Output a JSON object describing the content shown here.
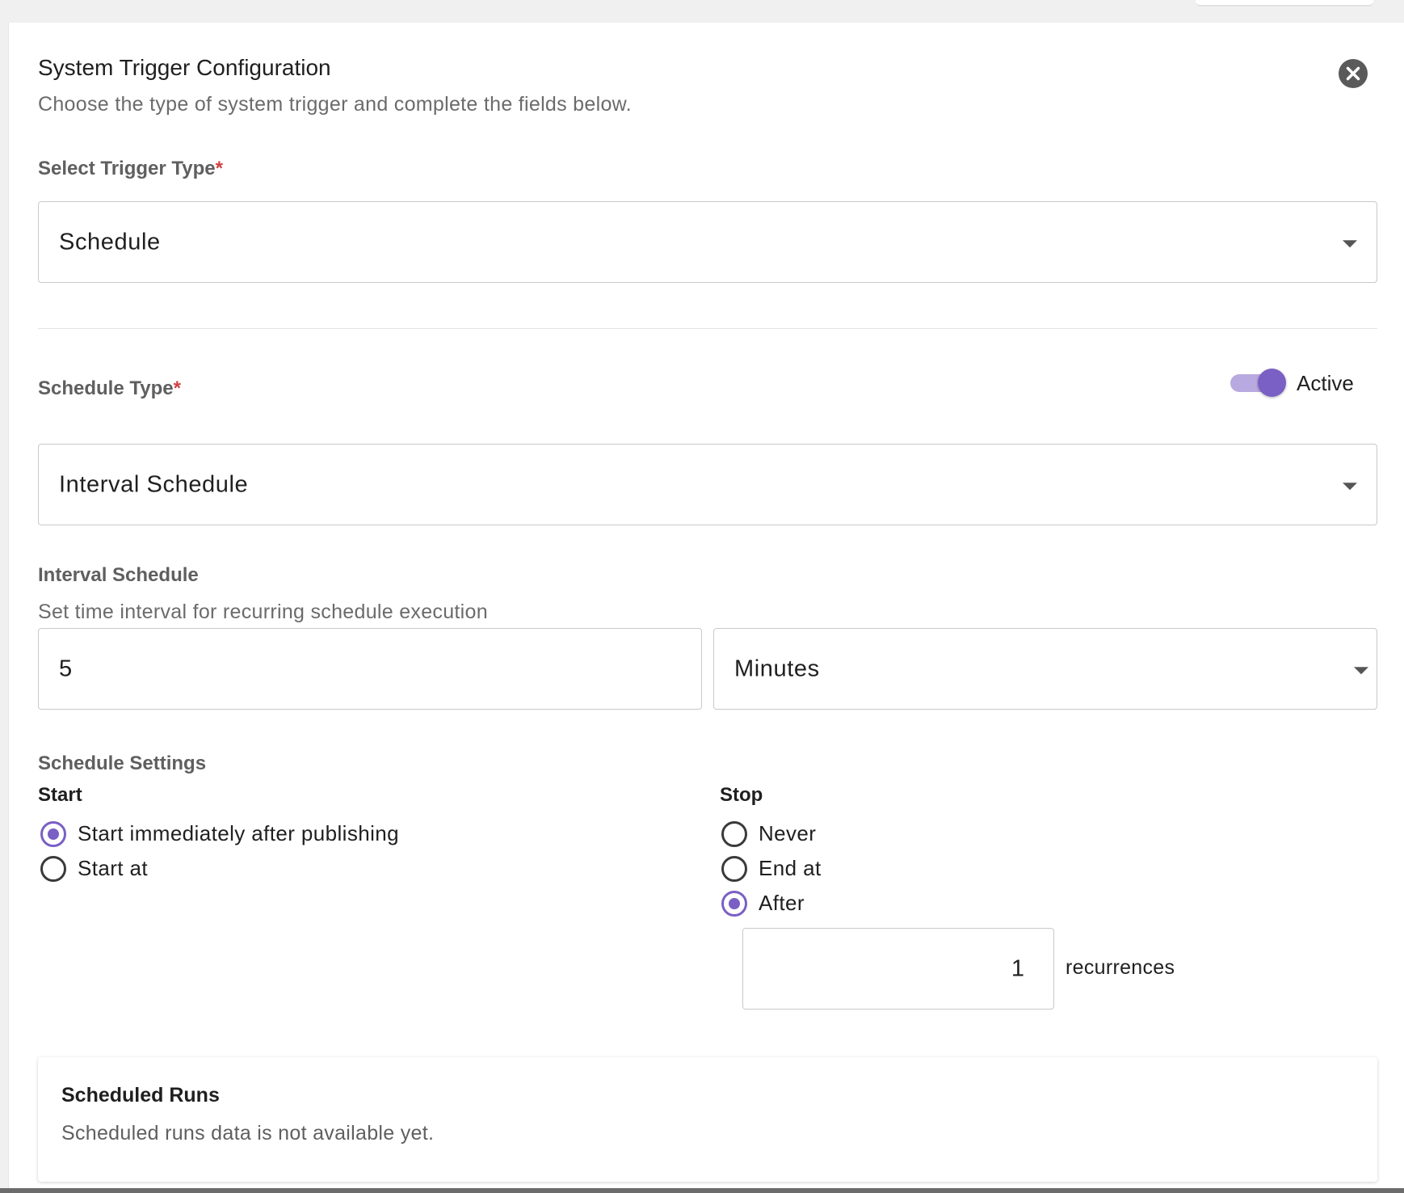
{
  "dialog": {
    "title": "System Trigger Configuration",
    "subtitle": "Choose the type of system trigger and complete the fields below.",
    "close_icon": "close-circle-icon"
  },
  "trigger_type": {
    "label": "Select Trigger Type",
    "required_mark": "*",
    "value": "Schedule"
  },
  "schedule_type": {
    "label": "Schedule Type",
    "required_mark": "*",
    "value": "Interval Schedule",
    "toggle_label": "Active",
    "toggle_on": true
  },
  "interval": {
    "title": "Interval Schedule",
    "helper": "Set time interval for recurring schedule execution",
    "amount": "5",
    "unit": "Minutes"
  },
  "settings": {
    "title": "Schedule Settings",
    "start": {
      "heading": "Start",
      "options": [
        {
          "label": "Start immediately after publishing",
          "checked": true
        },
        {
          "label": "Start at",
          "checked": false
        }
      ]
    },
    "stop": {
      "heading": "Stop",
      "options": [
        {
          "label": "Never",
          "checked": false
        },
        {
          "label": "End at",
          "checked": false
        },
        {
          "label": "After",
          "checked": true
        }
      ],
      "recurrence_count": "1",
      "recurrence_label": "recurrences"
    }
  },
  "scheduled_runs": {
    "title": "Scheduled Runs",
    "message": "Scheduled runs data is not available yet."
  },
  "colors": {
    "accent": "#7a5fc4",
    "accent_light": "#b8a9e0",
    "required": "#d04040"
  }
}
